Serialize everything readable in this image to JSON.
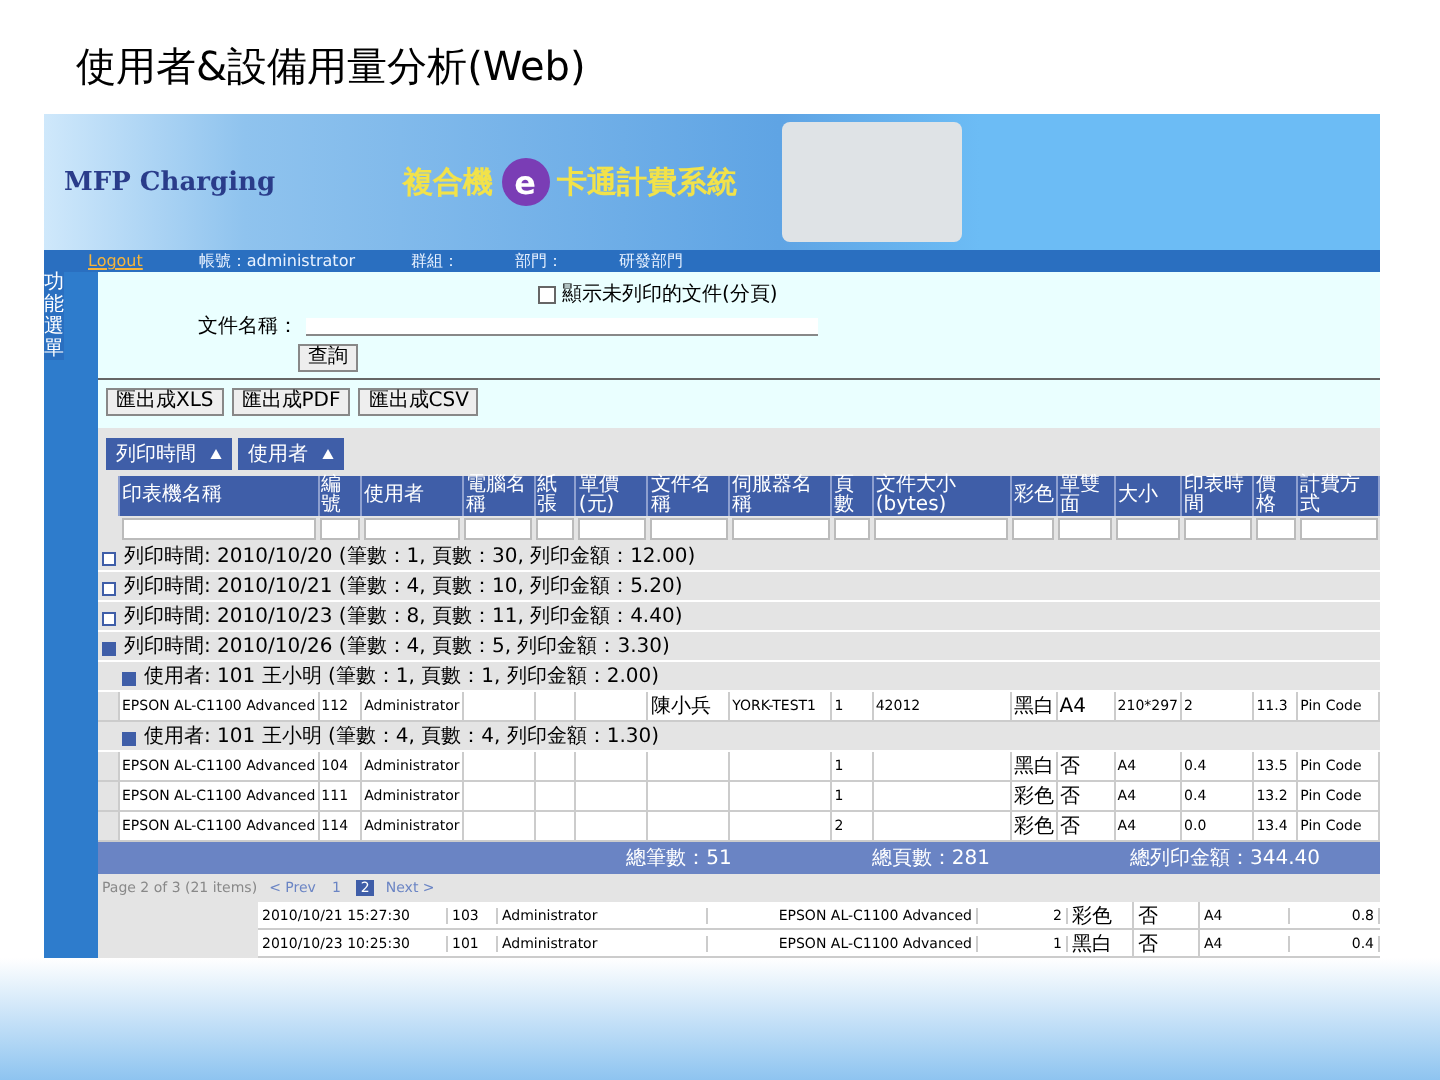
{
  "slide_title": "使用者&設備用量分析(Web)",
  "banner": {
    "logo": "MFP Charging",
    "title_left": "複合機",
    "title_mark": "e",
    "title_right": "卡通計費系統"
  },
  "navbar": {
    "logout": "Logout",
    "account": "帳號：administrator",
    "group": "群組：",
    "department": "部門：",
    "department_value": "研發部門"
  },
  "sidebar": {
    "items": [
      {
        "label": "功能選單"
      }
    ]
  },
  "search": {
    "option_label": "顯示未列印的文件(分頁)",
    "option_checked": false,
    "field_label": "文件名稱：",
    "button": "查詢"
  },
  "export_buttons": [
    "匯出成XLS",
    "匯出成PDF",
    "匯出成CSV"
  ],
  "group_chips": [
    "列印時間",
    "使用者"
  ],
  "columns": [
    "印表機名稱",
    "編號",
    "使用者",
    "電腦名稱",
    "紙張",
    "單價(元)",
    "文件名稱",
    "伺服器名稱",
    "頁數",
    "文件大小(bytes)",
    "彩色",
    "單雙面",
    "大小",
    "印表時間",
    "價格",
    "計費方式"
  ],
  "groups": [
    {
      "label": "列印時間: 2010/10/20 (筆數：1, 頁數：30, 列印金額：12.00)",
      "expanded": false
    },
    {
      "label": "列印時間: 2010/10/21 (筆數：4, 頁數：10, 列印金額：5.20)",
      "expanded": false
    },
    {
      "label": "列印時間: 2010/10/23 (筆數：8, 頁數：11, 列印金額：4.40)",
      "expanded": false
    },
    {
      "label": "列印時間: 2010/10/26 (筆數：4, 頁數：5, 列印金額：3.30)",
      "expanded": true,
      "subgroups": [
        {
          "label": "使用者: 101 王小明 (筆數：1, 頁數：1, 列印金額：2.00)",
          "rows": [
            {
              "printer": "EPSON AL-C1100 Advanced",
              "user_id": "112",
              "user": "Administrator",
              "doc": "陳小兵",
              "server": "YORK-TEST1",
              "pages": "1",
              "size": "42012",
              "color_mode": "黑白",
              "duplex": "A4",
              "dimensions": "210*297",
              "price_each": "2",
              "price": "11.3",
              "billing": "Pin Code"
            }
          ]
        },
        {
          "label": "使用者: 101 王小明 (筆數：4, 頁數：4, 列印金額：1.30)",
          "rows": [
            {
              "printer": "EPSON AL-C1100 Advanced",
              "user_id": "104",
              "user": "Administrator",
              "pages": "1",
              "color_mode": "黑白",
              "duplex": "否",
              "dimensions": "A4",
              "price_each": "0.4",
              "price": "13.5",
              "billing": "Pin Code"
            },
            {
              "printer": "EPSON AL-C1100 Advanced",
              "user_id": "111",
              "user": "Administrator",
              "pages": "1",
              "color_mode": "彩色",
              "duplex": "否",
              "dimensions": "A4",
              "price_each": "0.4",
              "price": "13.2",
              "billing": "Pin Code"
            },
            {
              "printer": "EPSON AL-C1100 Advanced",
              "user_id": "114",
              "user": "Administrator",
              "pages": "2",
              "color_mode": "彩色",
              "duplex": "否",
              "dimensions": "A4",
              "price_each": "0.0",
              "price": "13.4",
              "billing": "Pin Code"
            }
          ]
        }
      ]
    }
  ],
  "summary": [
    "總筆數：51",
    "總頁數：281",
    "總列印金額：344.40"
  ],
  "pager": {
    "info": "Page 2 of 3 (21 items)",
    "prev": "< Prev",
    "pages": [
      {
        "label": "1",
        "selected": false
      },
      {
        "label": "2",
        "selected": true
      }
    ],
    "next": "Next >"
  },
  "lower_rows": [
    {
      "time": "2010/10/21 15:27:30",
      "user_id": "103",
      "user": "Administrator",
      "printer": "EPSON AL-C1100 Advanced",
      "pages": "2",
      "color_mode": "彩色",
      "duplex": "否",
      "paper": "A4",
      "price": "0.8"
    },
    {
      "time": "2010/10/23 10:25:30",
      "user_id": "101",
      "user": "Administrator",
      "printer": "EPSON AL-C1100 Advanced",
      "pages": "1",
      "color_mode": "黑白",
      "duplex": "否",
      "paper": "A4",
      "price": "0.4"
    }
  ]
}
